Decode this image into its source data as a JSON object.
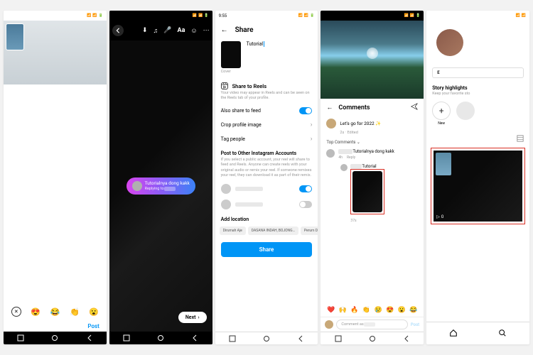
{
  "status": {
    "time": "9:55"
  },
  "s1": {
    "post_label": "Post"
  },
  "s2": {
    "reply_main": "Tutorialnya dong kakk",
    "reply_sub": "Replying to",
    "next_label": "Next"
  },
  "s3": {
    "title": "Share",
    "caption": "Tutorial",
    "cover_label": "Cover",
    "reels_hdr": "Share to Reels",
    "reels_desc": "Your video may appear in Reels and can be seen on the Reels tab of your profile.",
    "row_feed": "Also share to feed",
    "row_crop": "Crop profile image",
    "row_tag": "Tag people",
    "post_other_hdr": "Post to Other Instagram Accounts",
    "post_other_desc": "If you select a public account, your reel will share to feed and Reels. Anyone can create reels with your original audio or remix your reel. If someone remixes your reel, they can download it as part of their remix.",
    "add_location": "Add location",
    "locations": [
      "Dirumah Aje",
      "DASANA INDAH, BOJONG…",
      "Perum Dasan"
    ],
    "share_btn": "Share"
  },
  "s4": {
    "comments_title": "Comments",
    "caption": "Let's go for 2022 ✨",
    "caption_meta": "2s · Edited",
    "sort": "Top Comments",
    "c1_name": "",
    "c1_text": "Tutorialnya dong kakk",
    "c1_meta_time": "4h",
    "c1_meta_reply": "Reply",
    "reply_label": "Tutorial",
    "reply_time": "37s",
    "input_ph": "Comment as",
    "post_label": "Post"
  },
  "s5": {
    "edit": "E",
    "hl_title": "Story highlights",
    "hl_desc": "Keep your favorite sto",
    "hl_new": "New",
    "views": "0"
  }
}
